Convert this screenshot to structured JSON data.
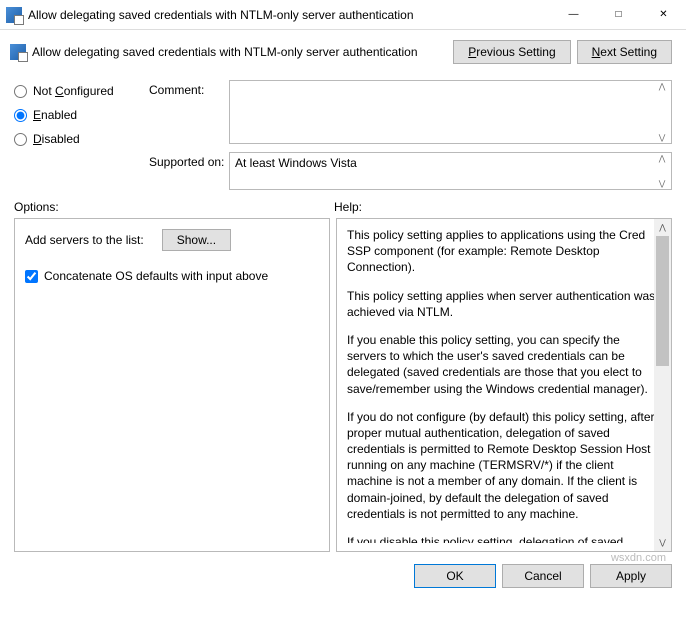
{
  "titlebar": {
    "title": "Allow delegating saved credentials with NTLM-only server authentication"
  },
  "header": {
    "title": "Allow delegating saved credentials with NTLM-only server authentication",
    "previous_label": "Previous Setting",
    "previous_hotkey": "P",
    "next_label": "Next Setting",
    "next_hotkey": "N"
  },
  "state": {
    "not_configured_label": "Not Configured",
    "not_configured_hotkey": "C",
    "enabled_label": "Enabled",
    "enabled_hotkey": "E",
    "disabled_label": "Disabled",
    "disabled_hotkey": "D",
    "selected": "enabled"
  },
  "fields": {
    "comment_label": "Comment:",
    "comment_value": "",
    "supported_label": "Supported on:",
    "supported_value": "At least Windows Vista"
  },
  "sections": {
    "options_label": "Options:",
    "help_label": "Help:"
  },
  "options": {
    "add_servers_label": "Add servers to the list:",
    "show_button": "Show...",
    "concatenate_label": "Concatenate OS defaults with input above",
    "concatenate_checked": true
  },
  "help": {
    "p1": "This policy setting applies to applications using the Cred SSP component (for example: Remote Desktop Connection).",
    "p2": "This policy setting applies when server authentication was achieved via NTLM.",
    "p3": "If you enable this policy setting, you can specify the servers to which the user's saved credentials can be delegated (saved credentials are those that you elect to save/remember using the Windows credential manager).",
    "p4": "If you do not configure (by default) this policy setting, after proper mutual authentication, delegation of saved credentials is permitted to Remote Desktop Session Host running on any machine (TERMSRV/*) if the client machine is not a member of any domain. If the client is domain-joined, by default the delegation of saved credentials is not permitted to any machine.",
    "p5": "If you disable this policy setting, delegation of saved credentials is not permitted to any machine."
  },
  "footer": {
    "ok": "OK",
    "cancel": "Cancel",
    "apply": "Apply"
  },
  "watermark": "wsxdn.com"
}
